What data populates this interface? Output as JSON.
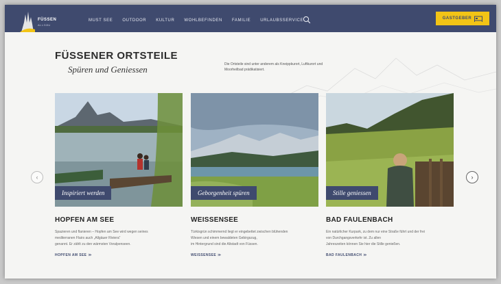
{
  "brand": {
    "name": "FÜSSEN",
    "tagline": "ALLGÄU"
  },
  "nav": {
    "items": [
      {
        "label": "MUST SEE"
      },
      {
        "label": "OUTDOOR"
      },
      {
        "label": "KULTUR"
      },
      {
        "label": "WOHLBEFINDEN"
      },
      {
        "label": "FAMILIE"
      },
      {
        "label": "URLAUBSSERVICE"
      }
    ],
    "host_button": "GASTGEBER"
  },
  "intro": {
    "title": "FÜSSENER ORTSTEILE",
    "subtitle": "Spüren und Geniessen",
    "text": "Die Ortsteile sind unter anderem als Kneippkurort, Luftkurort und Moorheilbad prädikatisiert."
  },
  "cards": [
    {
      "caption": "Inspiriert werden",
      "title": "HOPFEN AM SEE",
      "lines": [
        "Spazieren und flanieren – Hopfen am See wird wegen seines",
        "mediterranen Flairs auch „Allgäuer Riviera“",
        "genannt. Er zählt zu den wärmsten Voralpenseen."
      ],
      "link": "HOPFEN AM SEE"
    },
    {
      "caption": "Geborgenheit spüren",
      "title": "WEISSENSEE",
      "lines": [
        "Türkisgrün schimmernd liegt er eingebettet zwischen blühenden",
        "Wiesen und einem bewaldeten Gebirgszug,",
        "im Hintergrund sind die Altstadt von Füssen."
      ],
      "link": "WEISSENSEE"
    },
    {
      "caption": "Stille geniessen",
      "title": "BAD FAULENBACH",
      "lines": [
        "Ein natürlicher Kurpark, zu dem nur eine Straße führt und der frei",
        "von Durchgangsverkehr ist. Zu allen",
        "Jahreszeiten können Sie hier die Stille genießen."
      ],
      "link": "BAD FAULENBACH"
    }
  ],
  "colors": {
    "navy": "#3f4a6e",
    "accent": "#f2c416"
  },
  "icons": {
    "search": "search-icon",
    "bed": "bed-icon",
    "prev": "chevron-left-icon",
    "next": "chevron-right-icon",
    "link": "double-chevron-icon"
  }
}
